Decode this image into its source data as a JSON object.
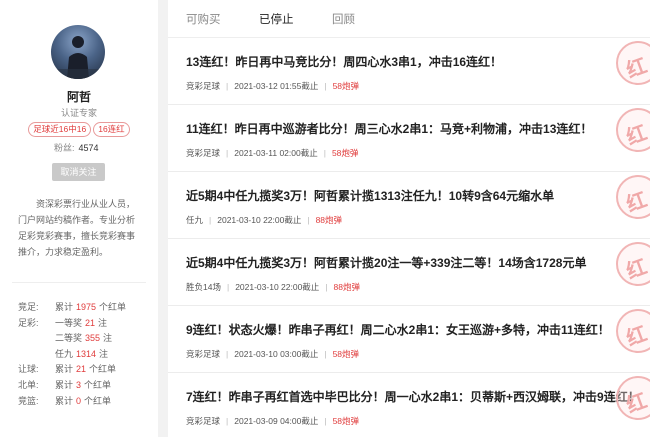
{
  "profile": {
    "name": "阿哲",
    "role": "认证专家",
    "badges": [
      "足球近16中16",
      "16连红"
    ],
    "fans_label": "粉丝:",
    "fans_count": "4574",
    "unfollow_label": "取消关注",
    "bio": "资深彩票行业从业人员，门户网站约稿作者。专业分析足彩竞彩赛事，擅长竞彩赛事推介，力求稳定盈利。"
  },
  "stats": [
    {
      "label": "竞足:",
      "prefix": "累计",
      "value": "1975",
      "suffix": "个红单"
    },
    {
      "label": "足彩:",
      "prefix": "一等奖",
      "value": "21",
      "suffix": "注"
    },
    {
      "label": "",
      "prefix": "二等奖",
      "value": "355",
      "suffix": "注"
    },
    {
      "label": "",
      "prefix": "任九",
      "value": "1314",
      "suffix": "注"
    },
    {
      "label": "让球:",
      "prefix": "累计",
      "value": "21",
      "suffix": "个红单"
    },
    {
      "label": "北单:",
      "prefix": "累计",
      "value": "3",
      "suffix": "个红单"
    },
    {
      "label": "竞篮:",
      "prefix": "累计",
      "value": "0",
      "suffix": "个红单"
    }
  ],
  "tabs": [
    "可购买",
    "已停止",
    "回顾"
  ],
  "stamp_text": "红",
  "articles": [
    {
      "title": "13连红！昨日再中马竞比分！周四心水3串1，冲击16连红！",
      "category": "竞彩足球",
      "time": "2021-03-12 01:55截止",
      "price": "58炮弹"
    },
    {
      "title": "11连红！昨日再中巡游者比分！周三心水2串1：马竞+利物浦，冲击13连红！",
      "category": "竞彩足球",
      "time": "2021-03-11 02:00截止",
      "price": "58炮弹"
    },
    {
      "title": "近5期4中任九揽奖3万！阿哲累计揽1313注任九！10转9含64元缩水单",
      "category": "任九",
      "time": "2021-03-10 22:00截止",
      "price": "88炮弹"
    },
    {
      "title": "近5期4中任九揽奖3万！阿哲累计揽20注一等+339注二等！14场含1728元单",
      "category": "胜负14场",
      "time": "2021-03-10 22:00截止",
      "price": "88炮弹"
    },
    {
      "title": "9连红！状态火爆！昨串子再红！周二心水2串1：女王巡游+多特，冲击11连红！",
      "category": "竞彩足球",
      "time": "2021-03-10 03:00截止",
      "price": "58炮弹"
    },
    {
      "title": "7连红！昨串子再红首选中毕巴比分！周一心水2串1：贝蒂斯+西汉姆联，冲击9连红！",
      "category": "竞彩足球",
      "time": "2021-03-09 04:00截止",
      "price": "58炮弹"
    }
  ]
}
